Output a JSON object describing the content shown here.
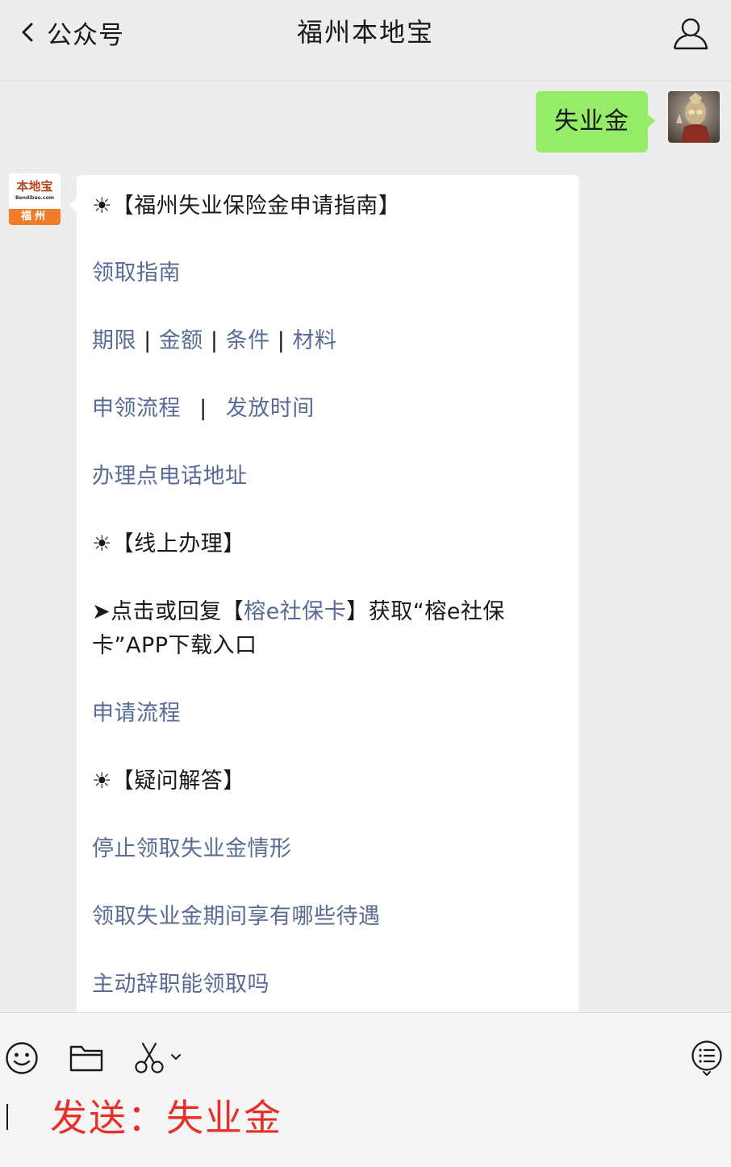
{
  "header": {
    "back_label": "公众号",
    "title": "福州本地宝",
    "back_icon": "chevron-left-icon",
    "profile_icon": "person-icon"
  },
  "messages": {
    "user": {
      "text": "失业金"
    },
    "bot": {
      "avatar_brand": "本地宝",
      "avatar_url": "Bendibao.com",
      "avatar_city": "福州",
      "section1_heading": "☀【福州失业保险金申请指南】",
      "guide_link": "领取指南",
      "period_link": "期限",
      "amount_link": "金额",
      "conditions_link": "条件",
      "materials_link": "材料",
      "separator": "|",
      "process_link": "申领流程",
      "payout_time_link": "发放时间",
      "offices_link": "办理点电话地址",
      "section2_heading": "☀【线上办理】",
      "online_prefix": "➤点击或回复【",
      "online_link": "榕e社保卡",
      "online_suffix": "】获取“榕e社保卡”APP下载入口",
      "apply_process_link": "申请流程",
      "section3_heading": "☀【疑问解答】",
      "faq_stop_link": "停止领取失业金情形",
      "faq_benefits_link": "领取失业金期间享有哪些待遇",
      "faq_resign_link": "主动辞职能领取吗"
    }
  },
  "input_bar": {
    "emoji_icon": "emoji-icon",
    "folder_icon": "folder-icon",
    "scissors_icon": "scissors-icon",
    "menu_icon": "menu-list-icon",
    "composer_text": "发送：失业金"
  },
  "colors": {
    "link": "#576b95",
    "user_bubble": "#95ec69",
    "composer_text": "#e8302b",
    "background": "#ededed"
  }
}
